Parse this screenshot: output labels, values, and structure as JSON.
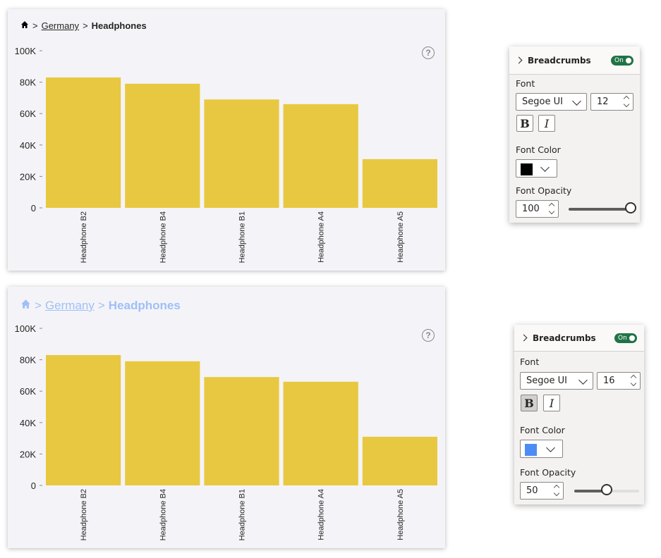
{
  "visual_top": {
    "breadcrumb": {
      "home_icon": "home-icon",
      "sep1": ">",
      "level1": "Germany",
      "sep2": ">",
      "current": "Headphones",
      "color": "#000000",
      "opacity": 1.0
    },
    "help_label": "?"
  },
  "visual_bottom": {
    "breadcrumb": {
      "home_icon": "home-icon",
      "sep1": ">",
      "level1": "Germany",
      "sep2": ">",
      "current": "Headphones",
      "color": "#4c8cf5",
      "opacity": 0.5
    },
    "help_label": "?"
  },
  "chart_data": [
    {
      "type": "bar",
      "categories": [
        "Headphone B2",
        "Headphone B4",
        "Headphone B1",
        "Headphone A4",
        "Headphone A5"
      ],
      "values": [
        83000,
        79000,
        69000,
        66000,
        31000
      ],
      "ylim": [
        0,
        100000
      ],
      "yticks": [
        "0",
        "20K",
        "40K",
        "60K",
        "80K",
        "100K"
      ],
      "bar_color": "#e8c840",
      "grid": false
    },
    {
      "type": "bar",
      "categories": [
        "Headphone B2",
        "Headphone B4",
        "Headphone B1",
        "Headphone A4",
        "Headphone A5"
      ],
      "values": [
        83000,
        79000,
        69000,
        66000,
        31000
      ],
      "ylim": [
        0,
        100000
      ],
      "yticks": [
        "0",
        "20K",
        "40K",
        "60K",
        "80K",
        "100K"
      ],
      "bar_color": "#e8c840",
      "grid": false
    }
  ],
  "panel_top": {
    "title": "Breadcrumbs",
    "toggle": "On",
    "font_label": "Font",
    "font_family": "Segoe UI",
    "font_size": "12",
    "bold_label": "B",
    "italic_label": "I",
    "bold_active": false,
    "font_color_label": "Font Color",
    "font_color": "#000000",
    "font_opacity_label": "Font Opacity",
    "font_opacity": "100",
    "opacity_fraction": 1.0
  },
  "panel_bottom": {
    "title": "Breadcrumbs",
    "toggle": "On",
    "font_label": "Font",
    "font_family": "Segoe UI",
    "font_size": "16",
    "bold_label": "B",
    "italic_label": "I",
    "bold_active": true,
    "font_color_label": "Font Color",
    "font_color": "#4c8cf5",
    "font_opacity_label": "Font Opacity",
    "font_opacity": "50",
    "opacity_fraction": 0.5
  }
}
